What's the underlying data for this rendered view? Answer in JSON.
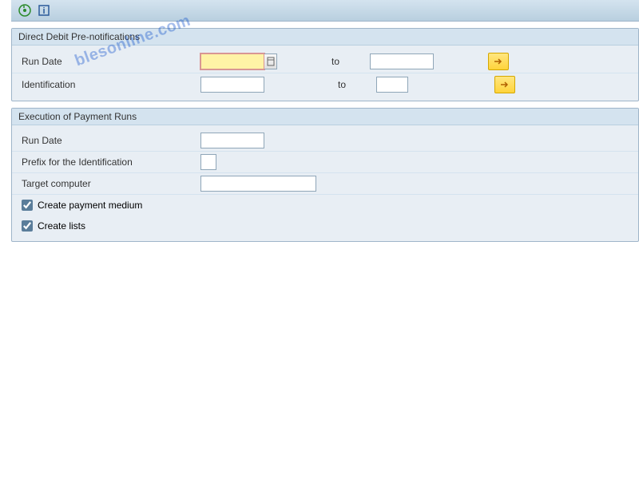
{
  "panel1": {
    "title": "Direct Debit Pre-notifications",
    "run_date_label": "Run Date",
    "identification_label": "Identification",
    "to_label": "to"
  },
  "panel2": {
    "title": "Execution of Payment Runs",
    "run_date_label": "Run Date",
    "prefix_label": "Prefix for the Identification",
    "target_label": "Target computer",
    "create_payment_label": "Create payment medium",
    "create_lists_label": "Create lists"
  },
  "watermark": "blesonline.com"
}
